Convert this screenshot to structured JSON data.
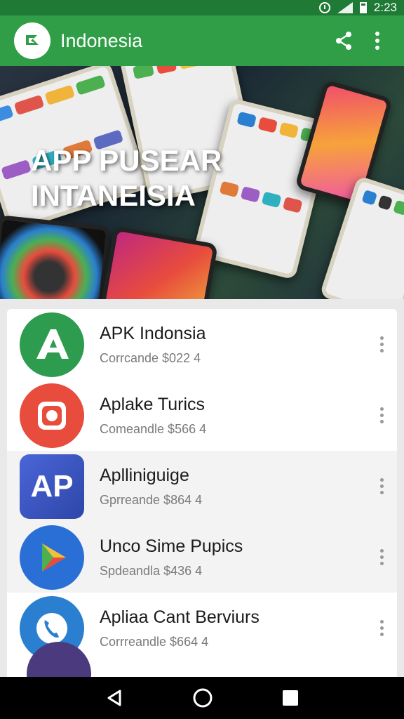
{
  "status_bar": {
    "time": "2:23",
    "icons": [
      "alarm-icon",
      "signal-icon",
      "battery-icon"
    ]
  },
  "app_bar": {
    "title": "Indonesia",
    "actions": [
      "share-icon",
      "more-vert-icon"
    ]
  },
  "hero": {
    "line1": "APP PUSEAR",
    "line2": "INTANEISIA"
  },
  "apps": [
    {
      "title": "APK Indonsia",
      "subtitle": "Corrcande $022 4",
      "icon": "apk-logo-icon",
      "color": "#2e9c4f"
    },
    {
      "title": "Aplake Turics",
      "subtitle": "Comeandle $566 4",
      "icon": "camera-logo-icon",
      "color": "#e84c3d"
    },
    {
      "title": "Aplliniguige",
      "subtitle": "Gprreande $864 4",
      "icon": "ap-logo-icon",
      "color": "#3b5bc4"
    },
    {
      "title": "Unco Sime Pupics",
      "subtitle": "Spdeandla $436 4",
      "icon": "play-logo-icon",
      "color": "#2a6fd6"
    },
    {
      "title": "Apliaa Cant Berviurs",
      "subtitle": "Corrreandle $664 4",
      "icon": "phone-logo-icon",
      "color": "#2b7fd0"
    }
  ],
  "nav": [
    "back-icon",
    "home-icon",
    "recents-icon"
  ]
}
